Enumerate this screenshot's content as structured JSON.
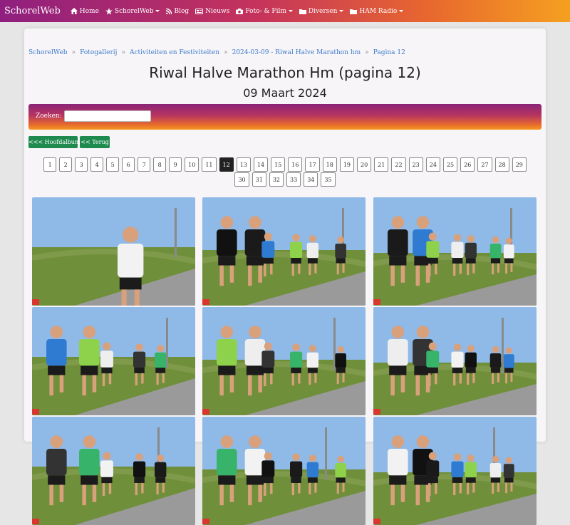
{
  "nav": {
    "brand": "SchorelWeb",
    "items": [
      {
        "label": "Home",
        "icon": "home-icon",
        "dropdown": false
      },
      {
        "label": "SchorelWeb",
        "icon": "star-icon",
        "dropdown": true
      },
      {
        "label": "Blog",
        "icon": "rss-icon",
        "dropdown": false
      },
      {
        "label": "Nieuws",
        "icon": "newspaper-icon",
        "dropdown": false
      },
      {
        "label": "Foto- & Film",
        "icon": "camera-icon",
        "dropdown": true
      },
      {
        "label": "Diversen",
        "icon": "folder-icon",
        "dropdown": true
      },
      {
        "label": "HAM Radio",
        "icon": "folder-icon",
        "dropdown": true
      }
    ]
  },
  "breadcrumb": [
    "SchorelWeb",
    "Fotogallerij",
    "Activiteiten en Festiviteiten",
    "2024-03-09 - Riwal Halve Marathon hm",
    "Pagina 12"
  ],
  "page": {
    "title": "Riwal Halve Marathon Hm (pagina 12)",
    "date": "09 Maart 2024"
  },
  "search": {
    "label": "Zoeken:",
    "value": ""
  },
  "buttons": {
    "main_album": "<<< Hoofdalbum",
    "back": "<< Terug"
  },
  "pagination": {
    "pages": [
      "1",
      "2",
      "3",
      "4",
      "5",
      "6",
      "7",
      "8",
      "9",
      "10",
      "11",
      "12",
      "13",
      "14",
      "15",
      "16",
      "17",
      "18",
      "19",
      "20",
      "21",
      "22",
      "23",
      "24",
      "25",
      "26",
      "27",
      "28",
      "29",
      "30",
      "31",
      "32",
      "33",
      "34",
      "35"
    ],
    "current": "12"
  },
  "gallery": {
    "photo_count_visible": 9,
    "colors": {
      "sky": "#8fb9e6",
      "grass": "#6f8f3a",
      "road": "#9a9a9a"
    }
  },
  "colors": {
    "nav_gradient": [
      "#8f1f7f",
      "#f5a020"
    ],
    "link": "#3f7ccc",
    "button_green": "#1f8a4e",
    "active_page": "#222222"
  }
}
